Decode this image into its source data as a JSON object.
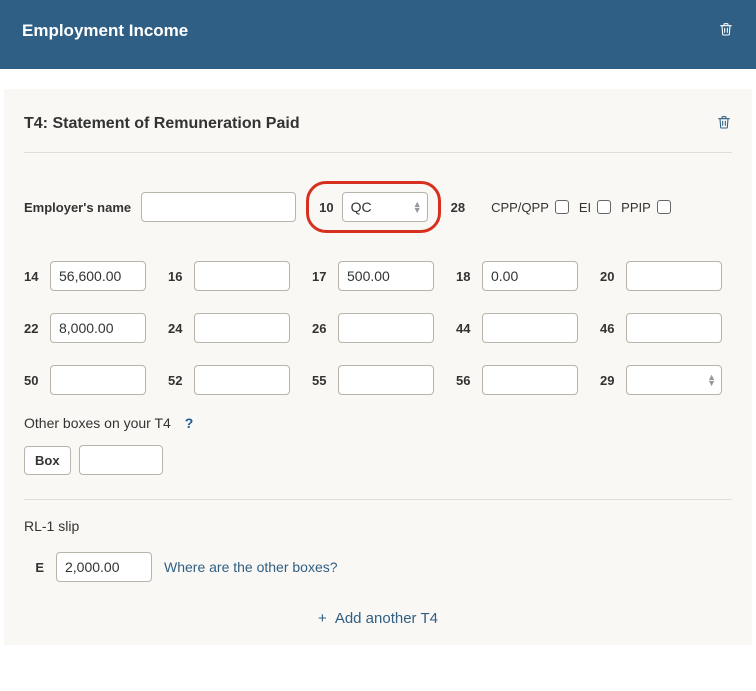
{
  "header": {
    "title": "Employment Income"
  },
  "panel": {
    "title": "T4: Statement of Remuneration Paid",
    "employer_label": "Employer's name",
    "employer_value": "",
    "box10_num": "10",
    "box10_value": "QC",
    "box28_num": "28",
    "chk_cpp": "CPP/QPP",
    "chk_ei": "EI",
    "chk_ppip": "PPIP",
    "boxes": [
      {
        "num": "14",
        "val": "56,600.00"
      },
      {
        "num": "16",
        "val": ""
      },
      {
        "num": "17",
        "val": "500.00"
      },
      {
        "num": "18",
        "val": "0.00"
      },
      {
        "num": "20",
        "val": ""
      },
      {
        "num": "22",
        "val": "8,000.00"
      },
      {
        "num": "24",
        "val": ""
      },
      {
        "num": "26",
        "val": ""
      },
      {
        "num": "44",
        "val": ""
      },
      {
        "num": "46",
        "val": ""
      },
      {
        "num": "50",
        "val": ""
      },
      {
        "num": "52",
        "val": ""
      },
      {
        "num": "55",
        "val": ""
      },
      {
        "num": "56",
        "val": ""
      },
      {
        "num": "29",
        "val": ""
      }
    ],
    "other_label": "Other boxes on your T4",
    "box_pill": "Box",
    "rl1_label": "RL-1 slip",
    "rl1_box_e_num": "E",
    "rl1_box_e_val": "2,000.00",
    "rl1_link": "Where are the other boxes?",
    "add_label": "Add another T4"
  }
}
